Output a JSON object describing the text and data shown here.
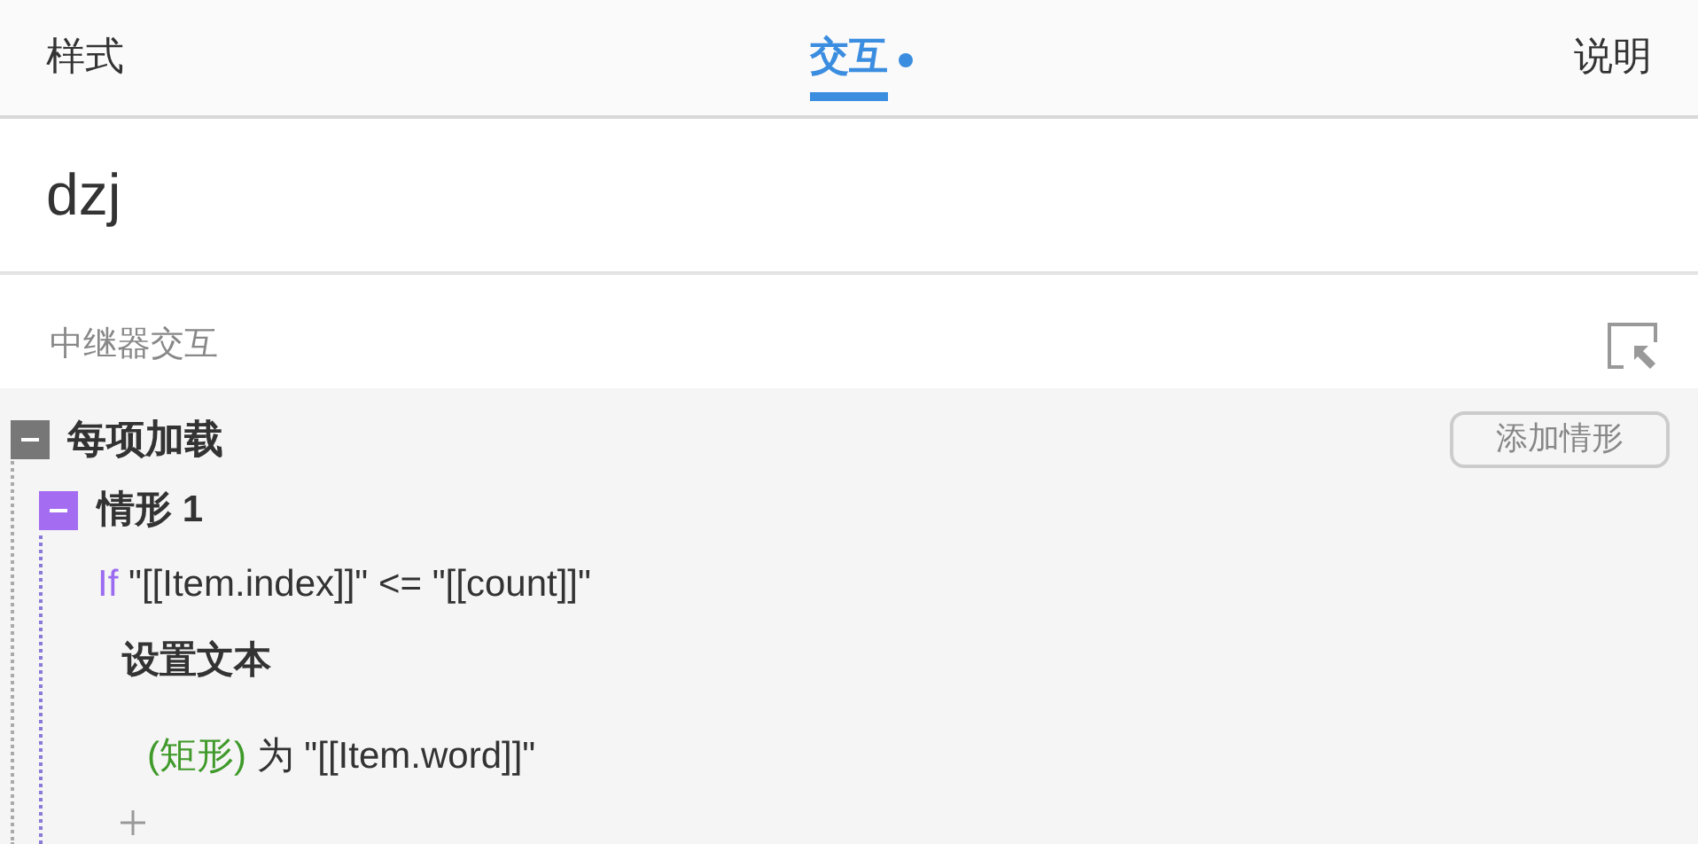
{
  "tabs": [
    {
      "label": "样式",
      "selected": false,
      "dot": false
    },
    {
      "label": "交互",
      "selected": true,
      "dot": true
    },
    {
      "label": "说明",
      "selected": false,
      "dot": false
    }
  ],
  "widget_name": "dzj",
  "section_title": "中继器交互",
  "events": [
    {
      "name": "每项加载",
      "expanded": true,
      "add_button": "添加情形",
      "cases": [
        {
          "name": "情形 1",
          "expanded": true,
          "condition": {
            "keyword": "If",
            "text": "\"[[Item.index]]\" <= \"[[count]]\""
          },
          "actions": [
            {
              "name": "设置文本",
              "targets": [
                {
                  "target": "(矩形)",
                  "text": "为 \"[[Item.word]]\""
                }
              ]
            }
          ]
        }
      ]
    }
  ]
}
